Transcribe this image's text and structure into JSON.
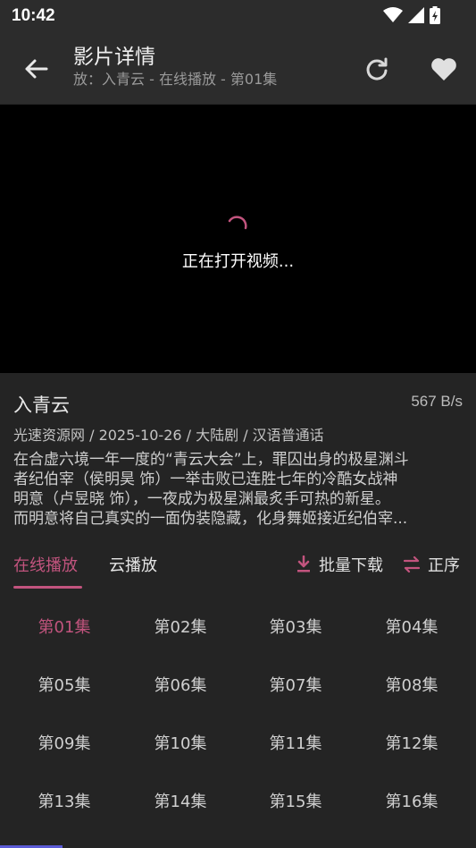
{
  "status_bar": {
    "time": "10:42"
  },
  "header": {
    "title": "影片详情",
    "subtitle": "放：入青云 - 在线播放 - 第01集"
  },
  "player": {
    "loading_text": "正在打开视频..."
  },
  "info": {
    "title": "入青云",
    "speed": "567 B/s",
    "meta": "光速资源网 / 2025-10-26 / 大陆剧 / 汉语普通话",
    "description_lines": [
      "在合虚六境一年一度的“青云大会”上，罪囚出身的极星渊斗",
      "者纪伯宰（侯明昊 饰）一举击败已连胜七年的冷酷女战神",
      "明意（卢昱晓 饰），一夜成为极星渊最炙手可热的新星。",
      "而明意将自己真实的一面伪装隐藏，化身舞姬接近纪伯宰..."
    ]
  },
  "tabs": {
    "online": "在线播放",
    "cloud": "云播放",
    "batch_download": "批量下载",
    "order": "正序"
  },
  "episodes": [
    "第01集",
    "第02集",
    "第03集",
    "第04集",
    "第05集",
    "第06集",
    "第07集",
    "第08集",
    "第09集",
    "第10集",
    "第11集",
    "第12集",
    "第13集",
    "第14集",
    "第15集",
    "第16集"
  ],
  "selected_episode": "第01集",
  "colors": {
    "accent": "#c2547e",
    "background": "#242424",
    "appbar": "#2c2c2c",
    "player": "#000000"
  }
}
